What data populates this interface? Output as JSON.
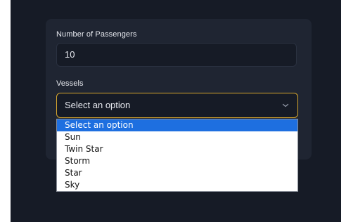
{
  "form": {
    "passengers_label": "Number of Passengers",
    "passengers_value": "10",
    "vessels_label": "Vessels",
    "vessels_selected": "Select an option",
    "vessels_options": [
      "Select an option",
      "Sun",
      "Twin Star",
      "Storm",
      "Star",
      "Sky"
    ]
  },
  "colors": {
    "background": "#161b26",
    "card": "#1f2532",
    "focus_border": "#d7a72e",
    "option_highlight": "#1e6fe0"
  },
  "icons": {
    "select_chevron": "chevron-down-icon"
  }
}
